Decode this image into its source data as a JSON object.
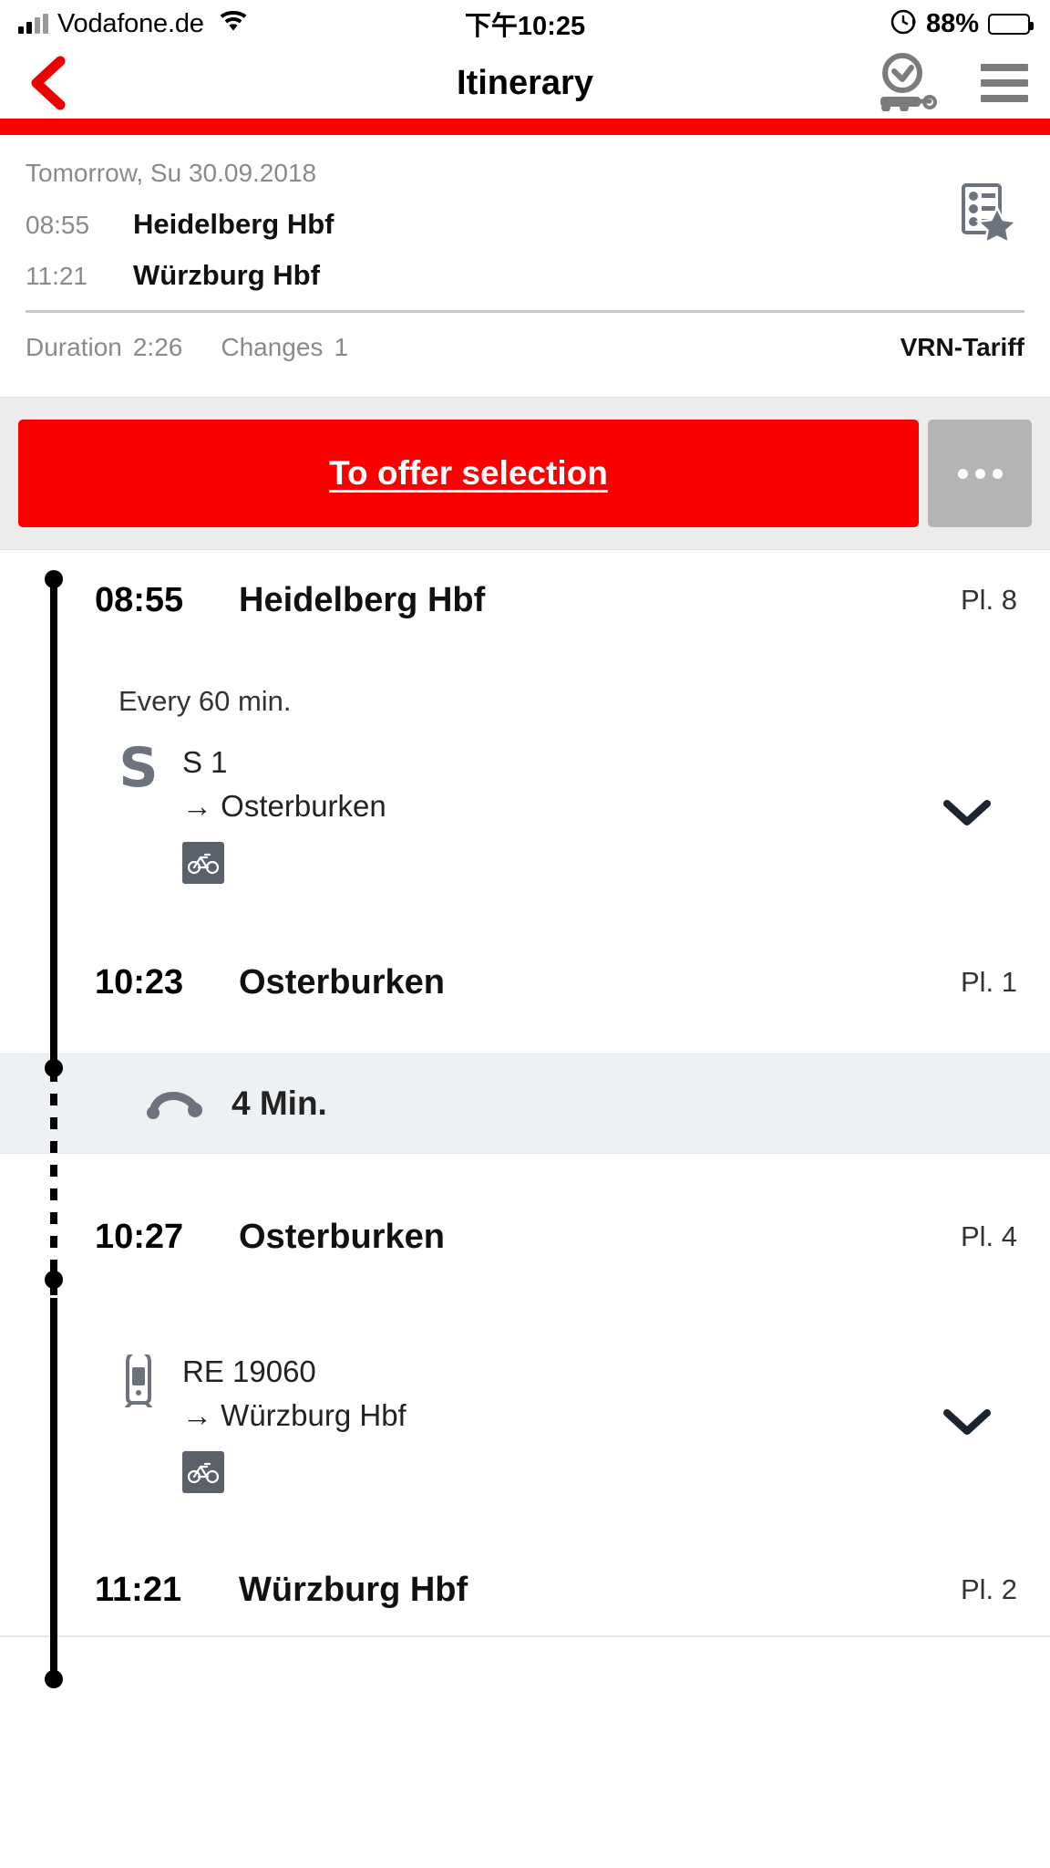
{
  "status_bar": {
    "carrier": "Vodafone.de",
    "time": "下午10:25",
    "battery_percent": "88%",
    "icons": {
      "signal": "signal-bars-icon",
      "wifi": "wifi-icon",
      "lock": "rotation-lock-icon",
      "battery": "battery-icon"
    }
  },
  "nav": {
    "title": "Itinerary",
    "back_icon": "chevron-left-icon",
    "live_icon": "live-journey-clock-icon",
    "menu_icon": "hamburger-menu-icon"
  },
  "summary": {
    "date": "Tomorrow, Su 30.09.2018",
    "departure": {
      "time": "08:55",
      "station": "Heidelberg Hbf"
    },
    "arrival": {
      "time": "11:21",
      "station": "Würzburg Hbf"
    },
    "duration_label": "Duration",
    "duration_value": "2:26",
    "changes_label": "Changes",
    "changes_value": "1",
    "tariff": "VRN-Tariff",
    "favorite_icon": "itinerary-star-icon"
  },
  "actions": {
    "primary_label": "To offer selection",
    "more_label": "…",
    "more_icon": "ellipsis-icon"
  },
  "journey": {
    "stops": [
      {
        "time": "08:55",
        "name": "Heidelberg Hbf",
        "platform": "Pl. 8"
      },
      {
        "time": "10:23",
        "name": "Osterburken",
        "platform": "Pl. 1"
      },
      {
        "time": "10:27",
        "name": "Osterburken",
        "platform": "Pl. 4"
      },
      {
        "time": "11:21",
        "name": "Würzburg Hbf",
        "platform": "Pl. 2"
      }
    ],
    "legs": [
      {
        "frequency": "Every 60 min.",
        "product_icon": "s-bahn-icon",
        "line": "S 1",
        "destination": "→ Osterburken",
        "attributes": [
          "bicycle-icon"
        ],
        "expand_icon": "chevron-down-icon"
      },
      {
        "frequency": "",
        "product_icon": "regional-train-icon",
        "line": "RE 19060",
        "destination": "→ Würzburg Hbf",
        "attributes": [
          "bicycle-icon"
        ],
        "expand_icon": "chevron-down-icon"
      }
    ],
    "transfer": {
      "duration": "4 Min.",
      "icon": "transfer-arc-icon"
    }
  },
  "colors": {
    "brand_red": "#ff0000",
    "button_red": "#fa0000",
    "action_bg": "#ececec",
    "transfer_bg": "#eef1f3",
    "badge_gray": "#5b616b",
    "muted_text": "#8a8a8a"
  }
}
